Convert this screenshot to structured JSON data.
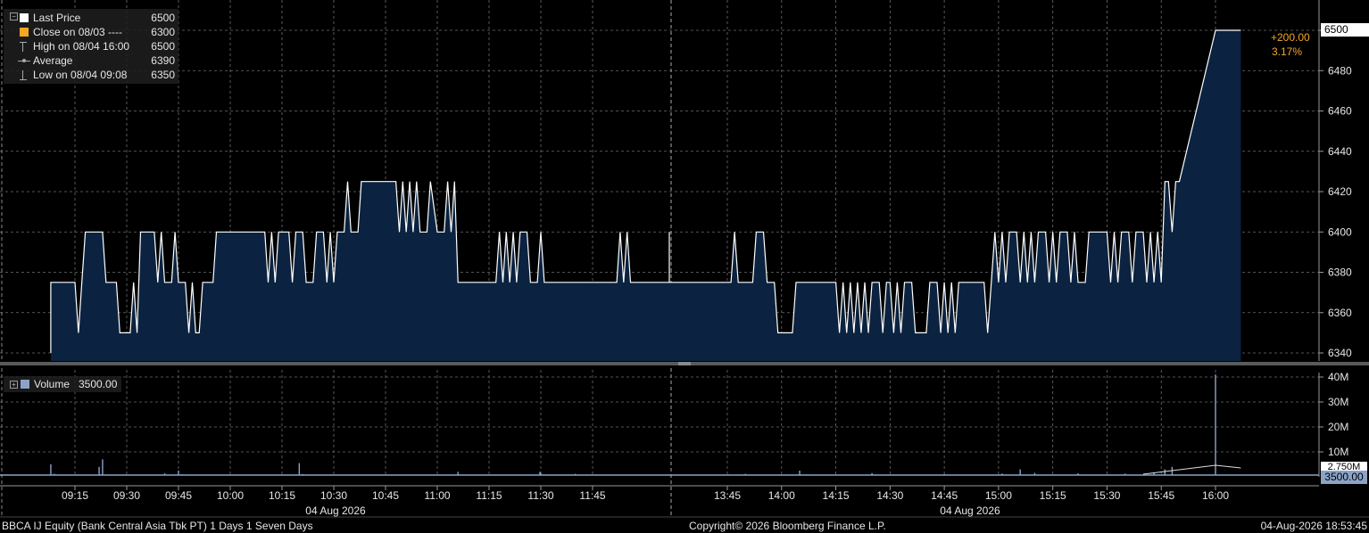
{
  "legend": {
    "last_price": {
      "label": "Last Price",
      "value": "6500",
      "color": "#ffffff"
    },
    "close": {
      "label": "Close on 08/03 ----",
      "value": "6300",
      "color": "#f5a623"
    },
    "high": {
      "label": "High on 08/04 16:00",
      "value": "6500"
    },
    "average": {
      "label": "Average",
      "value": "6390"
    },
    "low": {
      "label": "Low on 08/04 09:08",
      "value": "6350"
    }
  },
  "volume_legend": {
    "label": "Volume",
    "value": "3500.00"
  },
  "change": {
    "abs": "+200.00",
    "pct": "3.17%",
    "color": "#f5a623"
  },
  "price_tag": "6500",
  "volume_tag": "3500.00",
  "volume_partial_tag": "2.750M",
  "footer": {
    "left": "BBCA IJ Equity (Bank Central Asia Tbk PT) 1 Days 1 Seven Days",
    "center": "Copyright© 2026 Bloomberg Finance L.P.",
    "right": "04-Aug-2026 18:53:45"
  },
  "colors": {
    "area_fill": "#0b2340",
    "line": "#ffffff",
    "grid": "#6e6e6e",
    "accent": "#f5a623",
    "volume_bar": "#8ba3c7"
  },
  "chart_data": {
    "type": "area",
    "title": "",
    "ylim": [
      6335,
      6505
    ],
    "y_ticks": [
      "6340",
      "6360",
      "6380",
      "6400",
      "6420",
      "6440",
      "6460",
      "6480",
      "6500"
    ],
    "x_tick_labels": [
      "09:15",
      "09:30",
      "09:45",
      "10:00",
      "10:15",
      "10:30",
      "10:45",
      "11:00",
      "11:15",
      "11:30",
      "11:45",
      "13:45",
      "14:00",
      "14:15",
      "14:30",
      "14:45",
      "15:00",
      "15:15",
      "15:30",
      "15:45",
      "16:00"
    ],
    "date_labels": [
      "04 Aug 2026",
      "04 Aug 2026"
    ],
    "session_break": "11:45 – 13:45",
    "series": [
      {
        "name": "Last Price",
        "points": [
          [
            "09:08",
            6340
          ],
          [
            "09:08",
            6375
          ],
          [
            "09:15",
            6375
          ],
          [
            "09:16",
            6350
          ],
          [
            "09:17",
            6375
          ],
          [
            "09:18",
            6400
          ],
          [
            "09:23",
            6400
          ],
          [
            "09:24",
            6375
          ],
          [
            "09:27",
            6375
          ],
          [
            "09:28",
            6350
          ],
          [
            "09:31",
            6350
          ],
          [
            "09:32",
            6375
          ],
          [
            "09:33",
            6350
          ],
          [
            "09:34",
            6400
          ],
          [
            "09:38",
            6400
          ],
          [
            "09:39",
            6375
          ],
          [
            "09:40",
            6400
          ],
          [
            "09:41",
            6375
          ],
          [
            "09:43",
            6375
          ],
          [
            "09:44",
            6400
          ],
          [
            "09:45",
            6375
          ],
          [
            "09:47",
            6375
          ],
          [
            "09:48",
            6350
          ],
          [
            "09:49",
            6375
          ],
          [
            "09:50",
            6350
          ],
          [
            "09:51",
            6350
          ],
          [
            "09:52",
            6375
          ],
          [
            "09:55",
            6375
          ],
          [
            "09:56",
            6400
          ],
          [
            "10:10",
            6400
          ],
          [
            "10:11",
            6375
          ],
          [
            "10:12",
            6400
          ],
          [
            "10:13",
            6375
          ],
          [
            "10:14",
            6400
          ],
          [
            "10:17",
            6400
          ],
          [
            "10:18",
            6375
          ],
          [
            "10:19",
            6400
          ],
          [
            "10:21",
            6400
          ],
          [
            "10:22",
            6375
          ],
          [
            "10:24",
            6375
          ],
          [
            "10:25",
            6400
          ],
          [
            "10:27",
            6400
          ],
          [
            "10:28",
            6375
          ],
          [
            "10:29",
            6400
          ],
          [
            "10:30",
            6375
          ],
          [
            "10:31",
            6400
          ],
          [
            "10:33",
            6400
          ],
          [
            "10:34",
            6425
          ],
          [
            "10:35",
            6400
          ],
          [
            "10:37",
            6400
          ],
          [
            "10:38",
            6425
          ],
          [
            "10:48",
            6425
          ],
          [
            "10:49",
            6400
          ],
          [
            "10:50",
            6425
          ],
          [
            "10:51",
            6400
          ],
          [
            "10:52",
            6425
          ],
          [
            "10:53",
            6400
          ],
          [
            "10:54",
            6425
          ],
          [
            "10:55",
            6400
          ],
          [
            "10:57",
            6400
          ],
          [
            "10:58",
            6425
          ],
          [
            "11:00",
            6400
          ],
          [
            "11:02",
            6400
          ],
          [
            "11:03",
            6425
          ],
          [
            "11:04",
            6400
          ],
          [
            "11:05",
            6425
          ],
          [
            "11:06",
            6375
          ],
          [
            "11:17",
            6375
          ],
          [
            "11:18",
            6400
          ],
          [
            "11:19",
            6375
          ],
          [
            "11:20",
            6400
          ],
          [
            "11:21",
            6375
          ],
          [
            "11:22",
            6400
          ],
          [
            "11:23",
            6375
          ],
          [
            "11:24",
            6400
          ],
          [
            "11:26",
            6400
          ],
          [
            "11:27",
            6375
          ],
          [
            "11:29",
            6375
          ],
          [
            "11:30",
            6400
          ],
          [
            "11:31",
            6375
          ],
          [
            "11:52",
            6375
          ],
          [
            "11:53",
            6400
          ],
          [
            "11:54",
            6375
          ],
          [
            "11:55",
            6400
          ],
          [
            "11:56",
            6375
          ],
          [
            "12:13",
            6375
          ],
          [
            "12:14",
            6400
          ],
          [
            "12:15",
            6375
          ],
          [
            "12:16",
            6400
          ],
          [
            "12:17",
            6375
          ],
          [
            "12:19",
            6375
          ],
          [
            "12:20",
            6400
          ],
          [
            "12:21",
            6375
          ],
          [
            "12:22",
            6400
          ],
          [
            "12:23",
            6375
          ],
          [
            "12:24",
            6400
          ],
          [
            "12:25",
            6375
          ],
          [
            "12:27",
            6375
          ],
          [
            "12:28",
            6400
          ],
          [
            "12:29",
            6375
          ],
          [
            "12:31",
            6375
          ],
          [
            "12:32",
            6400
          ],
          [
            "12:33",
            6375
          ],
          [
            "13:30",
            6375
          ],
          [
            "13:46",
            6375
          ],
          [
            "13:47",
            6400
          ],
          [
            "13:48",
            6375
          ],
          [
            "13:52",
            6375
          ],
          [
            "13:53",
            6400
          ],
          [
            "13:55",
            6400
          ],
          [
            "13:56",
            6375
          ],
          [
            "13:58",
            6375
          ],
          [
            "13:59",
            6350
          ],
          [
            "14:03",
            6350
          ],
          [
            "14:04",
            6375
          ],
          [
            "14:15",
            6375
          ],
          [
            "14:16",
            6350
          ],
          [
            "14:17",
            6375
          ],
          [
            "14:18",
            6350
          ],
          [
            "14:19",
            6375
          ],
          [
            "14:20",
            6350
          ],
          [
            "14:21",
            6375
          ],
          [
            "14:22",
            6350
          ],
          [
            "14:23",
            6375
          ],
          [
            "14:24",
            6350
          ],
          [
            "14:25",
            6375
          ],
          [
            "14:27",
            6375
          ],
          [
            "14:28",
            6350
          ],
          [
            "14:29",
            6375
          ],
          [
            "14:30",
            6375
          ],
          [
            "14:31",
            6350
          ],
          [
            "14:32",
            6375
          ],
          [
            "14:33",
            6350
          ],
          [
            "14:34",
            6375
          ],
          [
            "14:36",
            6375
          ],
          [
            "14:37",
            6350
          ],
          [
            "14:40",
            6350
          ],
          [
            "14:41",
            6375
          ],
          [
            "14:43",
            6375
          ],
          [
            "14:44",
            6350
          ],
          [
            "14:45",
            6375
          ],
          [
            "14:46",
            6350
          ],
          [
            "14:47",
            6375
          ],
          [
            "14:48",
            6350
          ],
          [
            "14:49",
            6375
          ],
          [
            "14:56",
            6375
          ],
          [
            "14:57",
            6350
          ],
          [
            "14:58",
            6375
          ],
          [
            "14:59",
            6400
          ],
          [
            "15:00",
            6375
          ],
          [
            "15:01",
            6400
          ],
          [
            "15:02",
            6375
          ],
          [
            "15:03",
            6400
          ],
          [
            "15:05",
            6400
          ],
          [
            "15:06",
            6375
          ],
          [
            "15:07",
            6400
          ],
          [
            "15:08",
            6375
          ],
          [
            "15:09",
            6400
          ],
          [
            "15:10",
            6375
          ],
          [
            "15:11",
            6400
          ],
          [
            "15:13",
            6400
          ],
          [
            "15:14",
            6375
          ],
          [
            "15:15",
            6400
          ],
          [
            "15:16",
            6375
          ],
          [
            "15:17",
            6400
          ],
          [
            "15:19",
            6400
          ],
          [
            "15:20",
            6375
          ],
          [
            "15:21",
            6400
          ],
          [
            "15:22",
            6375
          ],
          [
            "15:24",
            6375
          ],
          [
            "15:25",
            6400
          ],
          [
            "15:30",
            6400
          ],
          [
            "15:31",
            6375
          ],
          [
            "15:32",
            6400
          ],
          [
            "15:33",
            6375
          ],
          [
            "15:34",
            6400
          ],
          [
            "15:36",
            6400
          ],
          [
            "15:37",
            6375
          ],
          [
            "15:38",
            6400
          ],
          [
            "15:40",
            6400
          ],
          [
            "15:41",
            6375
          ],
          [
            "15:42",
            6400
          ],
          [
            "15:43",
            6375
          ],
          [
            "15:44",
            6400
          ],
          [
            "15:45",
            6375
          ],
          [
            "15:46",
            6425
          ],
          [
            "15:47",
            6425
          ],
          [
            "15:48",
            6400
          ],
          [
            "15:49",
            6425
          ],
          [
            "15:50",
            6425
          ],
          [
            "16:00",
            6500
          ],
          [
            "16:07",
            6500
          ]
        ]
      }
    ],
    "volume": {
      "name": "Volume",
      "y_ticks": [
        "10M",
        "20M",
        "30M",
        "40M"
      ],
      "ylim": [
        0,
        42000000
      ],
      "bars": [
        [
          "09:08",
          5000000
        ],
        [
          "09:09",
          1200000
        ],
        [
          "09:12",
          800000
        ],
        [
          "09:22",
          4000000
        ],
        [
          "09:23",
          7000000
        ],
        [
          "09:25",
          800000
        ],
        [
          "09:41",
          1400000
        ],
        [
          "09:45",
          2500000
        ],
        [
          "09:46",
          1000000
        ],
        [
          "10:20",
          5500000
        ],
        [
          "10:21",
          1100000
        ],
        [
          "10:55",
          800000
        ],
        [
          "11:06",
          2000000
        ],
        [
          "11:30",
          1500000
        ],
        [
          "11:40",
          1200000
        ],
        [
          "12:20",
          900000
        ],
        [
          "12:55",
          2000000
        ],
        [
          "13:50",
          1200000
        ],
        [
          "14:05",
          2500000
        ],
        [
          "14:25",
          1500000
        ],
        [
          "14:45",
          1100000
        ],
        [
          "15:01",
          1300000
        ],
        [
          "15:06",
          3000000
        ],
        [
          "15:10",
          1600000
        ],
        [
          "15:22",
          1400000
        ],
        [
          "15:35",
          1300000
        ],
        [
          "15:43",
          1800000
        ],
        [
          "15:46",
          3000000
        ],
        [
          "15:48",
          4000000
        ],
        [
          "16:00",
          41000000
        ]
      ]
    }
  }
}
